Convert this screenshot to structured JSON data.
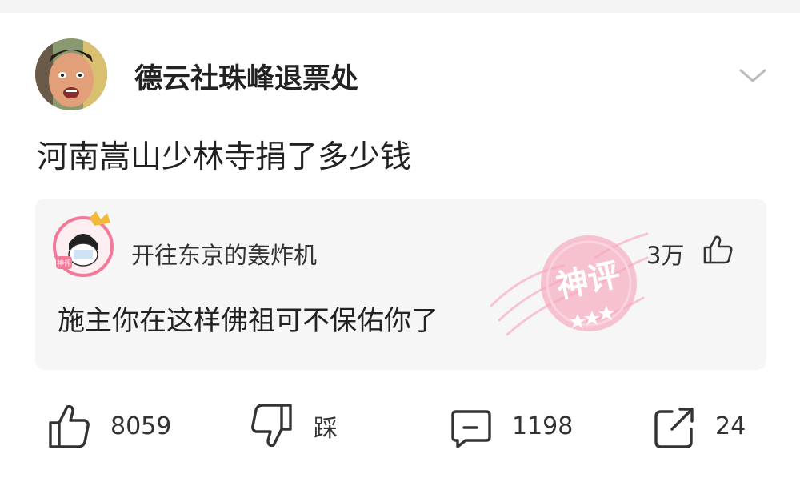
{
  "post": {
    "author": "德云社珠峰退票处",
    "text": "河南嵩山少林寺捐了多少钱"
  },
  "hot_comment": {
    "author": "开往东京的轰炸机",
    "likes": "3万",
    "text": "施主你在这样佛祖可不保佑你了",
    "badge": "神评"
  },
  "actions": {
    "like_count": "8059",
    "dislike_label": "踩",
    "comment_count": "1198",
    "share_count": "24"
  },
  "colors": {
    "text": "#222222",
    "card_bg": "#f6f6f6",
    "badge_pink": "#f06a8a"
  }
}
